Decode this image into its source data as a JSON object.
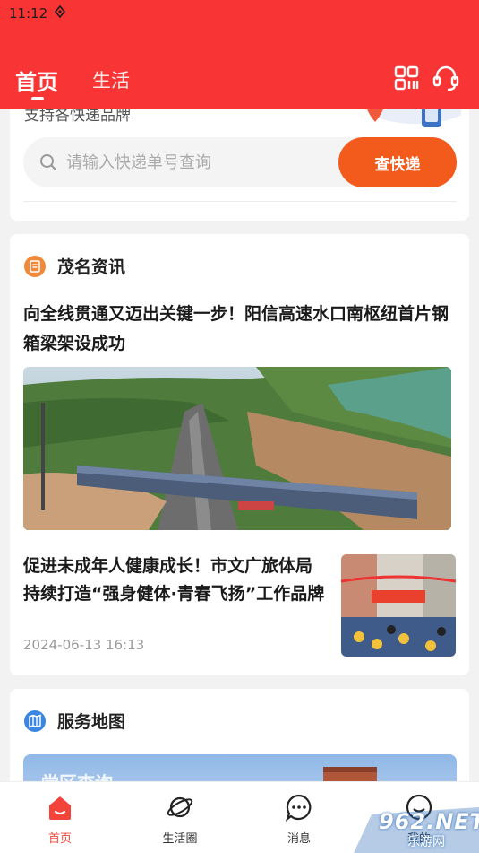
{
  "status_bar": {
    "time": "11:12"
  },
  "header": {
    "tabs": [
      {
        "label": "首页",
        "active": true
      },
      {
        "label": "生活",
        "active": false
      }
    ],
    "accent_color": "#f83434"
  },
  "express": {
    "subtitle": "支持各快递品牌",
    "search_placeholder": "请输入快递单号查询",
    "search_value": "",
    "button_label": "查快递",
    "button_color": "#f25b1c"
  },
  "news": {
    "section_title": "茂名资讯",
    "items": [
      {
        "headline": "向全线贯通又迈出关键一步！阳信高速水口南枢纽首片钢箱梁架设成功"
      },
      {
        "headline": "促进未成年人健康成长！市文广旅体局持续打造“强身健体·青春飞扬”工作品牌",
        "date": "2024-06-13 16:13"
      }
    ]
  },
  "service_map": {
    "section_title": "服务地图",
    "banner_text": "党区查询"
  },
  "bottom_nav": {
    "items": [
      {
        "label": "首页",
        "icon": "home-icon",
        "active": true
      },
      {
        "label": "生活圈",
        "icon": "planet-icon",
        "active": false
      },
      {
        "label": "消息",
        "icon": "message-icon",
        "active": false
      },
      {
        "label": "我的",
        "icon": "user-icon",
        "active": false
      }
    ]
  },
  "watermark": {
    "text": "962.NET",
    "sub": "乐游网"
  }
}
